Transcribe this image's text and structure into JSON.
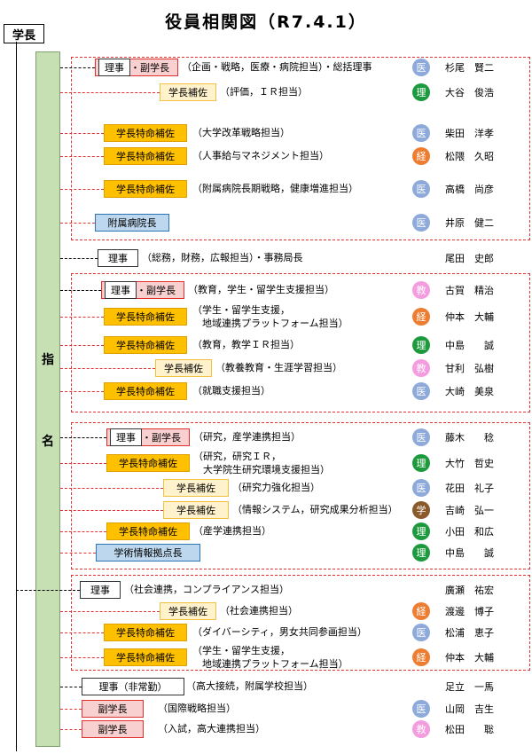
{
  "title": "役員相関図（R7.4.1）",
  "president": "学長",
  "shimei": [
    "指",
    "名"
  ],
  "badge_colors": {
    "医": "#8eaadb",
    "理": "#1e9a3e",
    "経": "#ed7d31",
    "教": "#f49ce0",
    "学": "#8b5a2b"
  },
  "rows": [
    {
      "kind": "riji-fuku",
      "role": "理事",
      "role2": "・副学長",
      "resp": "（企画・戦略，医療・病院担当）・総括理事",
      "badge": "医",
      "name": "杉尾　賢二"
    },
    {
      "kind": "hosa",
      "role": "学長補佐",
      "resp": "（評価，ＩＲ担当）",
      "badge": "理",
      "name": "大谷　俊浩"
    },
    {
      "kind": "tokumei",
      "role": "学長特命補佐",
      "resp": "（大学改革戦略担当）",
      "badge": "医",
      "name": "柴田　洋孝"
    },
    {
      "kind": "tokumei",
      "role": "学長特命補佐",
      "resp": "（人事給与マネジメント担当）",
      "badge": "経",
      "name": "松隈　久昭"
    },
    {
      "kind": "tokumei",
      "role": "学長特命補佐",
      "resp": "（附属病院長期戦略，健康増進担当）",
      "badge": "医",
      "name": "高橋　尚彦"
    },
    {
      "kind": "blue",
      "role": "附属病院長",
      "resp": "",
      "badge": "医",
      "name": "井原　健二"
    },
    {
      "kind": "riji",
      "role": "理事",
      "resp": "（総務，財務，広報担当）・事務局長",
      "badge": "",
      "name": "尾田　史郎"
    },
    {
      "kind": "riji-fuku",
      "role": "理事",
      "role2": "・副学長",
      "resp": "（教育，学生・留学生支援担当）",
      "badge": "教",
      "name": "古賀　精治"
    },
    {
      "kind": "tokumei",
      "role": "学長特命補佐",
      "resp": "（学生・留学生支援，\n　地域連携プラットフォーム担当）",
      "badge": "経",
      "name": "仲本　大輔"
    },
    {
      "kind": "tokumei",
      "role": "学長特命補佐",
      "resp": "（教育，教学ＩＲ担当）",
      "badge": "理",
      "name": "中島　　誠"
    },
    {
      "kind": "hosa",
      "role": "学長補佐",
      "resp": "（教養教育・生涯学習担当）",
      "badge": "教",
      "name": "甘利　弘樹"
    },
    {
      "kind": "tokumei",
      "role": "学長特命補佐",
      "resp": "（就職支援担当）",
      "badge": "医",
      "name": "大崎　美泉"
    },
    {
      "kind": "riji-fuku",
      "role": "理事",
      "role2": "・副学長",
      "resp": "（研究，産学連携担当）",
      "badge": "医",
      "name": "藤木　　稔"
    },
    {
      "kind": "tokumei",
      "role": "学長特命補佐",
      "resp": "（研究，研究ＩＲ，\n　大学院生研究環境支援担当）",
      "badge": "理",
      "name": "大竹　哲史"
    },
    {
      "kind": "hosa",
      "role": "学長補佐",
      "resp": "（研究力強化担当）",
      "badge": "医",
      "name": "花田　礼子"
    },
    {
      "kind": "hosa",
      "role": "学長補佐",
      "resp": "（情報システム，研究成果分析担当）",
      "badge": "学",
      "name": "吉崎　弘一"
    },
    {
      "kind": "tokumei",
      "role": "学長特命補佐",
      "resp": "（産学連携担当）",
      "badge": "理",
      "name": "小田　和広"
    },
    {
      "kind": "blue",
      "role": "学術情報拠点長",
      "resp": "",
      "badge": "理",
      "name": "中島　　誠"
    },
    {
      "kind": "riji",
      "role": "理事",
      "resp": "（社会連携，コンプライアンス担当）",
      "badge": "",
      "name": "廣瀬　祐宏"
    },
    {
      "kind": "hosa",
      "role": "学長補佐",
      "resp": "（社会連携担当）",
      "badge": "経",
      "name": "渡邊　博子"
    },
    {
      "kind": "tokumei",
      "role": "学長特命補佐",
      "resp": "（ダイバーシティ，男女共同参画担当）",
      "badge": "医",
      "name": "松浦　恵子"
    },
    {
      "kind": "tokumei",
      "role": "学長特命補佐",
      "resp": "（学生・留学生支援，\n　地域連携プラットフォーム担当）",
      "badge": "経",
      "name": "仲本　大輔"
    },
    {
      "kind": "riji",
      "role": "理事（非常勤）",
      "resp": "（高大接続，附属学校担当）",
      "badge": "",
      "name": "足立　一馬"
    },
    {
      "kind": "fuku",
      "role": "副学長",
      "resp": "（国際戦略担当）",
      "badge": "医",
      "name": "山岡　吉生"
    },
    {
      "kind": "fuku",
      "role": "副学長",
      "resp": "（入試，高大連携担当）",
      "badge": "教",
      "name": "松田　　聡"
    }
  ]
}
